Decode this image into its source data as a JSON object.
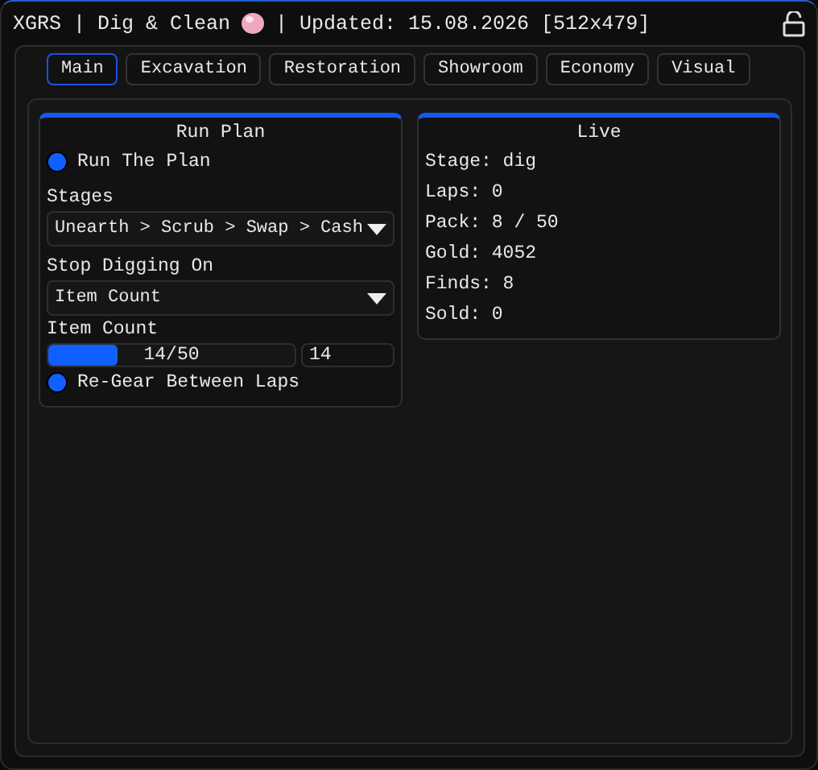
{
  "window": {
    "title_left": "XGRS | Dig & Clean",
    "title_right": "| Updated: 15.08.2026 [512x479]",
    "locked": false
  },
  "tabs": [
    {
      "label": "Main",
      "selected": true
    },
    {
      "label": "Excavation",
      "selected": false
    },
    {
      "label": "Restoration",
      "selected": false
    },
    {
      "label": "Showroom",
      "selected": false
    },
    {
      "label": "Economy",
      "selected": false
    },
    {
      "label": "Visual",
      "selected": false
    }
  ],
  "run_plan": {
    "title": "Run Plan",
    "items": [
      {
        "kind": "toggle",
        "label": "Run The Plan",
        "checked": true
      },
      {
        "kind": "dropdown",
        "label": "Stages",
        "value": "Unearth > Scrub > Swap > Cash"
      },
      {
        "kind": "dropdown",
        "label": "Stop Digging On",
        "value": "Item Count"
      },
      {
        "kind": "slider",
        "label": "Item Count",
        "reading": "14/50",
        "level": 0.28,
        "number": "14"
      },
      {
        "kind": "toggle",
        "label": "Re-Gear Between Laps",
        "checked": true
      }
    ]
  },
  "live": {
    "title": "Live",
    "lines": [
      "Stage: dig",
      "Laps: 0",
      "Pack: 8 / 50",
      "Gold: 4052",
      "Finds: 8",
      "Sold: 0"
    ]
  }
}
